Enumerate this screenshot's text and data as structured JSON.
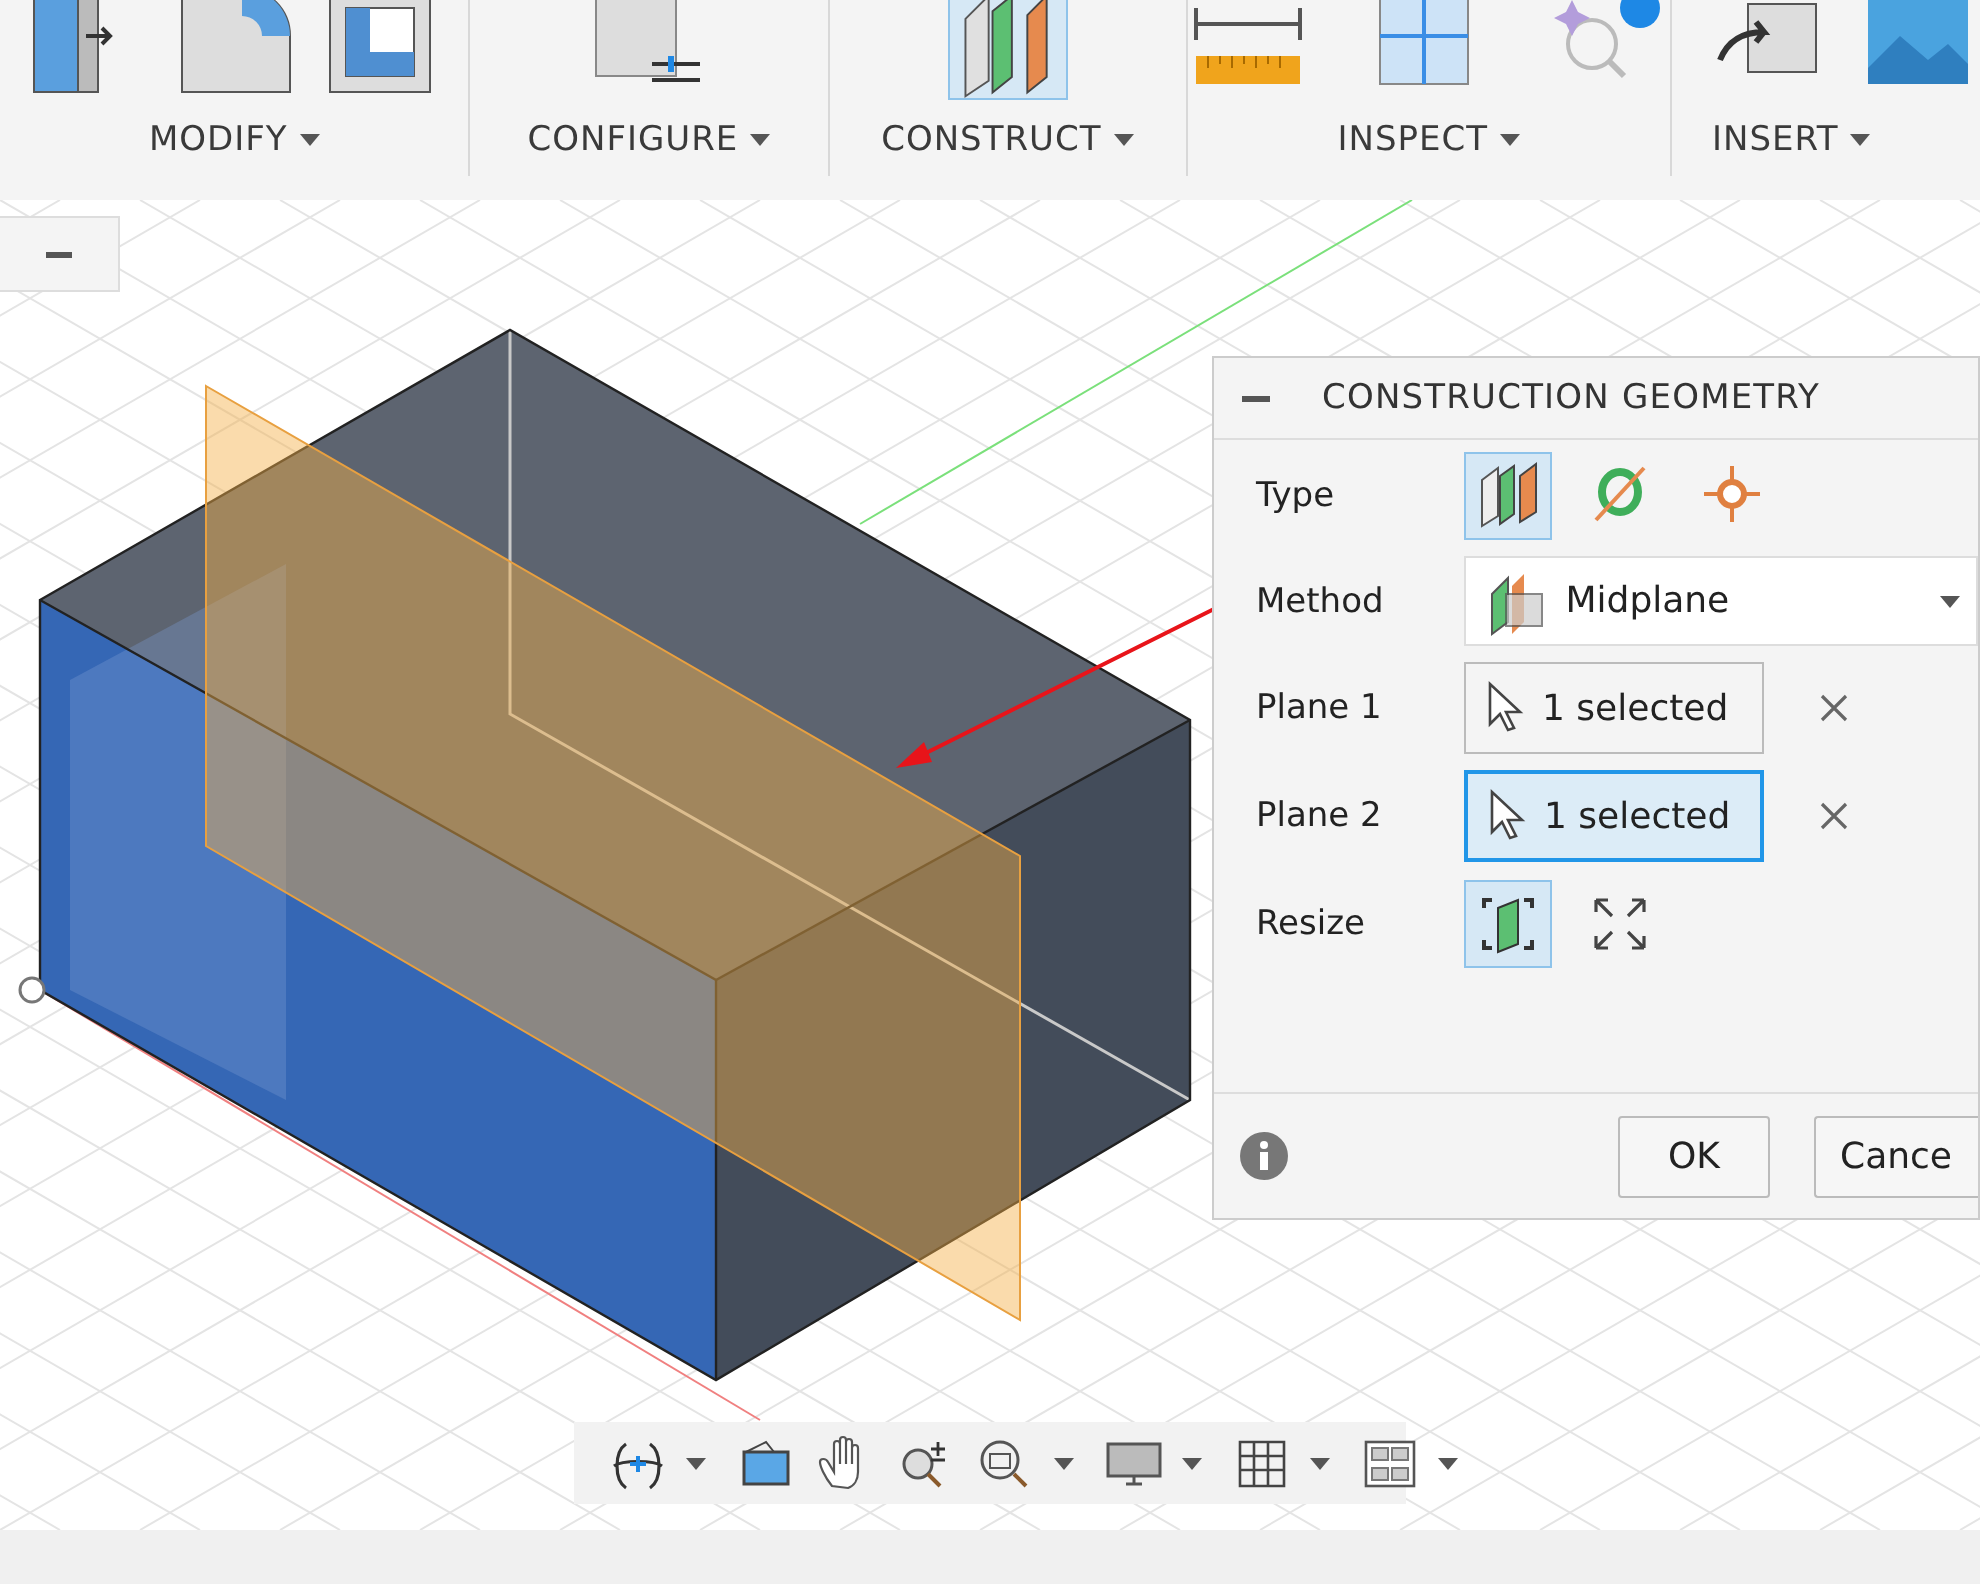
{
  "toolbar": {
    "groups": [
      {
        "label": "MODIFY",
        "selected": false,
        "tools": [
          {
            "kind": "pressPull"
          },
          {
            "kind": "fillet"
          },
          {
            "kind": "shell"
          }
        ]
      },
      {
        "label": "CONFIGURE",
        "selected": false,
        "tools": [
          {
            "kind": "configure"
          }
        ]
      },
      {
        "label": "CONSTRUCT",
        "selected": true,
        "tools": [
          {
            "kind": "planes"
          }
        ]
      },
      {
        "label": "INSPECT",
        "selected": false,
        "tools": [
          {
            "kind": "measure"
          },
          {
            "kind": "section"
          },
          {
            "kind": "inspectAi"
          }
        ]
      },
      {
        "label": "INSERT",
        "selected": false,
        "tools": [
          {
            "kind": "insert"
          },
          {
            "kind": "image"
          }
        ]
      }
    ]
  },
  "dialog": {
    "title": "CONSTRUCTION GEOMETRY",
    "rows": [
      {
        "kind": "choice",
        "label": "Type",
        "options": [
          {
            "kind": "plane",
            "selected": true
          },
          {
            "kind": "axis",
            "selected": false
          },
          {
            "kind": "point",
            "selected": false
          }
        ]
      },
      {
        "kind": "dropdown",
        "label": "Method",
        "value": "Midplane"
      },
      {
        "kind": "selection",
        "label": "Plane 1",
        "value": "1 selected",
        "focused": false
      },
      {
        "kind": "selection",
        "label": "Plane 2",
        "value": "1 selected",
        "focused": true
      },
      {
        "kind": "choice",
        "label": "Resize",
        "options": [
          {
            "kind": "fit",
            "selected": true
          },
          {
            "kind": "expand",
            "selected": false
          }
        ]
      }
    ],
    "buttons": [
      "OK",
      "Cance"
    ]
  },
  "nav_tools": [
    {
      "kind": "orbit",
      "menu": true
    },
    {
      "kind": "lookAt",
      "menu": false
    },
    {
      "kind": "pan",
      "menu": false
    },
    {
      "kind": "zoom",
      "menu": false
    },
    {
      "kind": "fitWindow",
      "menu": true
    },
    {
      "kind": "display",
      "menu": true
    },
    {
      "kind": "grid",
      "menu": true
    },
    {
      "kind": "viewports",
      "menu": true
    }
  ]
}
